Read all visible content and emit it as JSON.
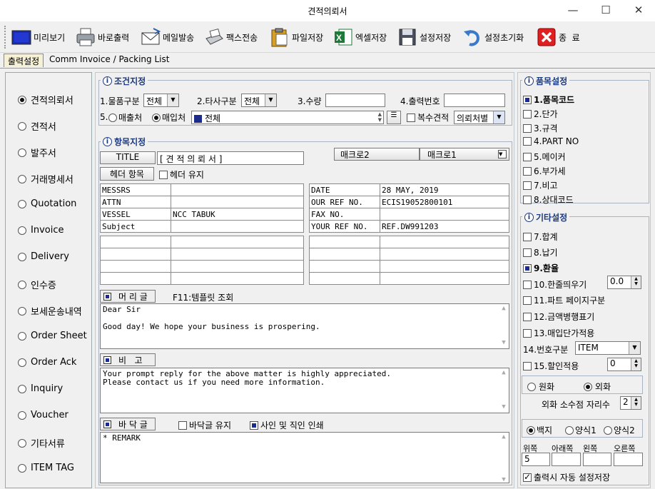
{
  "window": {
    "title": "견적의뢰서",
    "min": "—",
    "max": "☐",
    "close": "✕"
  },
  "toolbar": {
    "preview": "미리보기",
    "print": "바로출력",
    "email": "메일발송",
    "fax": "팩스전송",
    "file_save": "파일저장",
    "excel_save": "엑셀저장",
    "settings_save": "설정저장",
    "settings_reset": "설정초기화",
    "exit": "종  료"
  },
  "tabs": [
    "출력설정",
    "Comm Invoice / Packing List"
  ],
  "doc_types": [
    "견적의뢰서",
    "견적서",
    "발주서",
    "거래명세서",
    "Quotation",
    "Invoice",
    "Delivery",
    "인수증",
    "보세운송내역",
    "Order Sheet",
    "Order Ack",
    "Inquiry",
    "Voucher",
    "기타서류",
    "ITEM TAG"
  ],
  "selected_doc": "견적의뢰서",
  "condition": {
    "title": "조건지정",
    "item_class_label": "1.물품구분",
    "item_class_value": "전체",
    "other_class_label": "2.타사구분",
    "other_class_value": "전체",
    "qty_label": "3.수량",
    "qty_value": "",
    "output_no_label": "4.출력번호",
    "output_no_value": "",
    "opt5": "5.",
    "sales": "매출처",
    "purchase": "매입처",
    "partner_value": "전체",
    "multi_quote": "복수견적",
    "per_supplier": "의뢰처별"
  },
  "items": {
    "title": "항목지정",
    "title_btn": "TITLE",
    "title_value": "[ 견 적 의 뢰 서 ]",
    "macro2": "매크로2",
    "macro1": "매크로1",
    "header_btn": "헤더 항목",
    "header_keep": "헤더 유지",
    "left_grid": [
      [
        "MESSRS",
        ""
      ],
      [
        "ATTN",
        ""
      ],
      [
        "VESSEL",
        "NCC TABUK"
      ],
      [
        "Subject",
        ""
      ]
    ],
    "right_grid": [
      [
        "DATE",
        "28 MAY, 2019"
      ],
      [
        "OUR REF NO.",
        "ECIS19052800101"
      ],
      [
        "FAX NO.",
        ""
      ],
      [
        "YOUR REF NO.",
        "REF.DW991203"
      ]
    ],
    "preface_btn": "머 리 글",
    "preface_hint": "F11:템플릿 조회",
    "preface_text": "Dear Sir\n\nGood day! We hope your business is prospering.",
    "remark_btn": "비   고",
    "remark_text": "Your prompt reply for the above matter is highly appreciated.\nPlease contact us if you need more information.",
    "footer_btn": "바 닥 글",
    "footer_keep": "바닥글 유지",
    "sign_print": "사인 및 직인 인쇄",
    "footer_text": "* REMARK"
  },
  "item_settings": {
    "title": "품목설정",
    "options": [
      {
        "label": "1.품목코드",
        "checked": true
      },
      {
        "label": "2.단가",
        "checked": false
      },
      {
        "label": "3.규격",
        "checked": false
      },
      {
        "label": "4.PART NO",
        "checked": false
      },
      {
        "label": "5.메이커",
        "checked": false
      },
      {
        "label": "6.부가세",
        "checked": false
      },
      {
        "label": "7.비고",
        "checked": false
      },
      {
        "label": "8.상대코드",
        "checked": false
      }
    ]
  },
  "other_settings": {
    "title": "기타설정",
    "opt7": "7.합계",
    "opt8": "8.납기",
    "opt9": "9.환율",
    "opt10": "10.한줄띄우기",
    "opt10_value": "0.0",
    "opt11": "11.파트 페이지구분",
    "opt12": "12.금액병행표기",
    "opt13": "13.매입단가적용",
    "opt14": "14.번호구분",
    "opt14_value": "ITEM",
    "opt15": "15.할인적용",
    "opt15_value": "0",
    "won": "원화",
    "foreign": "외화",
    "decimals_label": "외화 소수점 자리수",
    "decimals_value": "2",
    "paper_blank": "백지",
    "form1": "양식1",
    "form2": "양식2",
    "margin_top": "위쪽",
    "margin_bottom": "아래쪽",
    "margin_left": "왼쪽",
    "margin_right": "오른쪽",
    "margin_top_value": "5",
    "auto_save": "출력시 자동 설정저장"
  }
}
